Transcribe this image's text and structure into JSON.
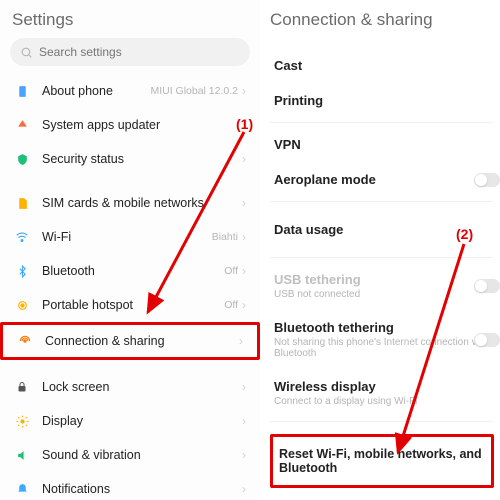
{
  "left": {
    "title": "Settings",
    "search_placeholder": "Search settings",
    "items": [
      {
        "label": "About phone",
        "value": "MIUI Global 12.0.2"
      },
      {
        "label": "System apps updater",
        "value": ""
      },
      {
        "label": "Security status",
        "value": ""
      },
      {
        "label": "SIM cards & mobile networks",
        "value": ""
      },
      {
        "label": "Wi-Fi",
        "value": "Biahti"
      },
      {
        "label": "Bluetooth",
        "value": "Off"
      },
      {
        "label": "Portable hotspot",
        "value": "Off"
      },
      {
        "label": "Connection & sharing",
        "value": ""
      },
      {
        "label": "Lock screen",
        "value": ""
      },
      {
        "label": "Display",
        "value": ""
      },
      {
        "label": "Sound & vibration",
        "value": ""
      },
      {
        "label": "Notifications",
        "value": ""
      }
    ]
  },
  "right": {
    "title": "Connection & sharing",
    "rows": {
      "cast": {
        "label": "Cast"
      },
      "printing": {
        "label": "Printing"
      },
      "vpn": {
        "label": "VPN"
      },
      "aeroplane": {
        "label": "Aeroplane mode"
      },
      "data": {
        "label": "Data usage"
      },
      "usb": {
        "label": "USB tethering",
        "sub": "USB not connected"
      },
      "bt_tether": {
        "label": "Bluetooth tethering",
        "sub": "Not sharing this phone's Internet connection via Bluetooth"
      },
      "wireless": {
        "label": "Wireless display",
        "sub": "Connect to a display using Wi-Fi"
      },
      "reset": {
        "label": "Reset Wi-Fi, mobile networks, and Bluetooth"
      }
    }
  },
  "annotations": {
    "one": "(1)",
    "two": "(2)"
  }
}
